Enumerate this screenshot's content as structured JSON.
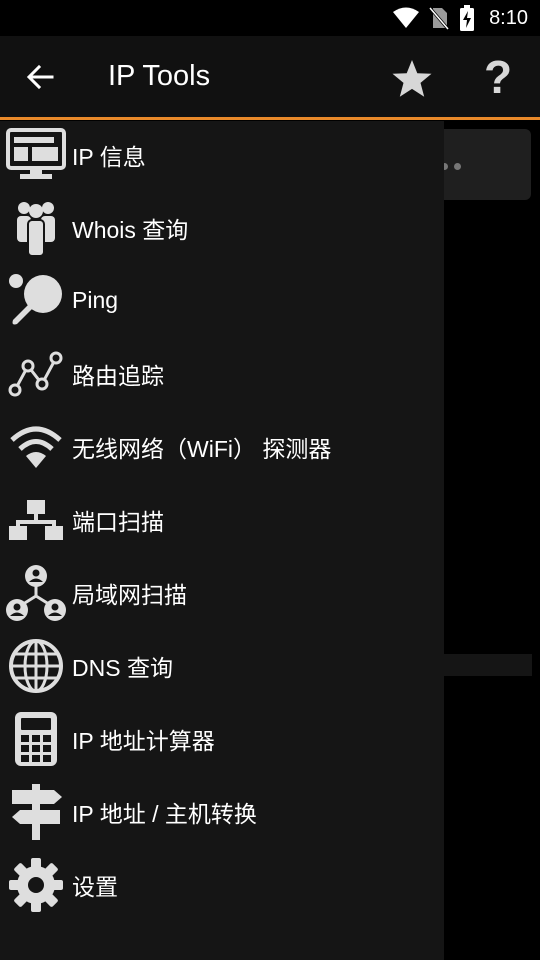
{
  "status_bar": {
    "time": "8:10",
    "icons": [
      "wifi-icon",
      "no-sim-icon",
      "battery-charging-icon"
    ]
  },
  "app_bar": {
    "title": "IP Tools",
    "back_icon": "arrow-left-icon",
    "favorite_icon": "star-icon",
    "help_icon": "question-icon",
    "help_glyph": "?"
  },
  "colors": {
    "accent": "#e98a2a",
    "drawer_bg": "#151515",
    "appbar_bg": "#111111",
    "icon": "#dedede"
  },
  "drawer": {
    "items": [
      {
        "label": "IP 信息",
        "icon": "monitor-icon"
      },
      {
        "label": "Whois 查询",
        "icon": "people-icon"
      },
      {
        "label": "Ping",
        "icon": "ping-pong-icon"
      },
      {
        "label": "路由追踪",
        "icon": "route-icon"
      },
      {
        "label": "无线网络（WiFi） 探测器",
        "icon": "wifi-icon"
      },
      {
        "label": "端口扫描",
        "icon": "network-blocks-icon"
      },
      {
        "label": "局域网扫描",
        "icon": "lan-users-icon"
      },
      {
        "label": "DNS 查询",
        "icon": "globe-icon"
      },
      {
        "label": "IP 地址计算器",
        "icon": "calculator-icon"
      },
      {
        "label": "IP 地址 / 主机转换",
        "icon": "signpost-icon"
      },
      {
        "label": "设置",
        "icon": "gear-icon"
      }
    ]
  }
}
